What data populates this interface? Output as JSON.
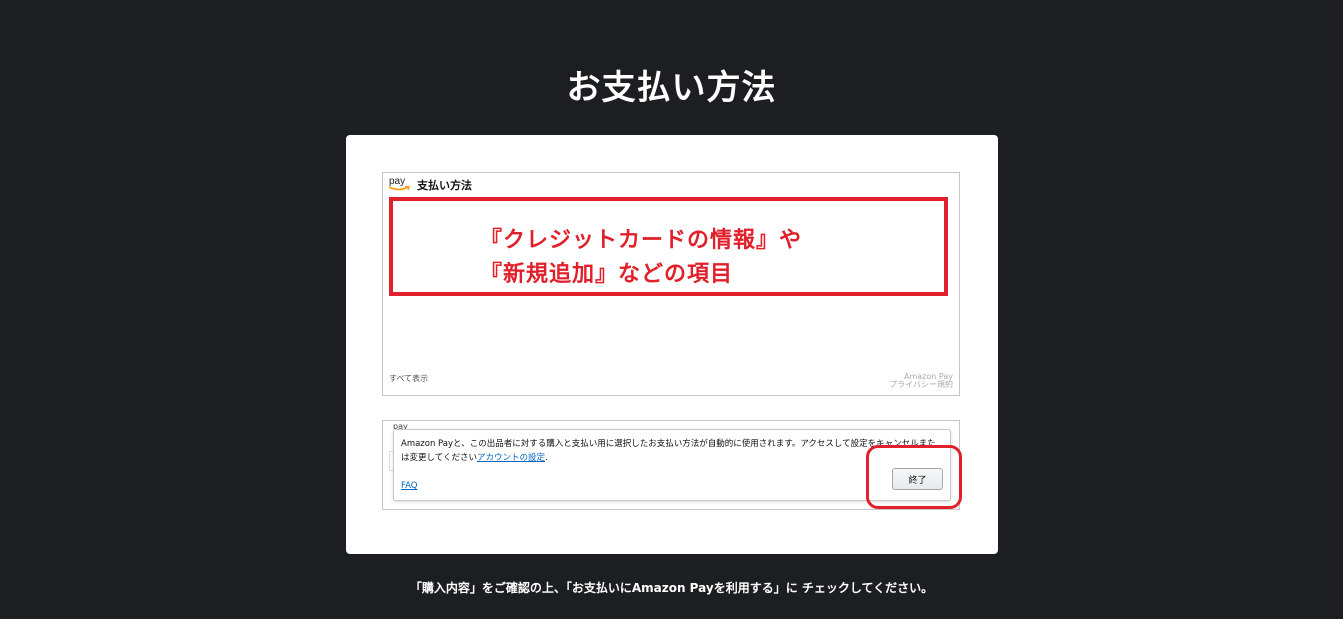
{
  "page": {
    "title": "お支払い方法",
    "instruction": "「購入内容」をご確認の上、「お支払いにAmazon Payを利用する」に チェックしてください。"
  },
  "wallet": {
    "logo_text": "pay",
    "title": "支払い方法",
    "annotation_line1": "『クレジットカードの情報』や",
    "annotation_line2": "『新規追加』などの項目",
    "show_all": "すべて表示",
    "brand": "Amazon Pay",
    "privacy_link": "プライバシー規約"
  },
  "consent": {
    "bg_label": "pay",
    "text": "Amazon Payと、この出品者に対する購入と支払い用に選択したお支払い方法が自動的に使用されます。アクセスして設定をキャンセルまたは変更してください",
    "account_link": "アカウントの設定",
    "period": ".",
    "faq": "FAQ",
    "close_label": "終了"
  },
  "colors": {
    "background": "#1d1e22",
    "annotation_red": "#e0202a",
    "link_blue": "#0066c0"
  }
}
